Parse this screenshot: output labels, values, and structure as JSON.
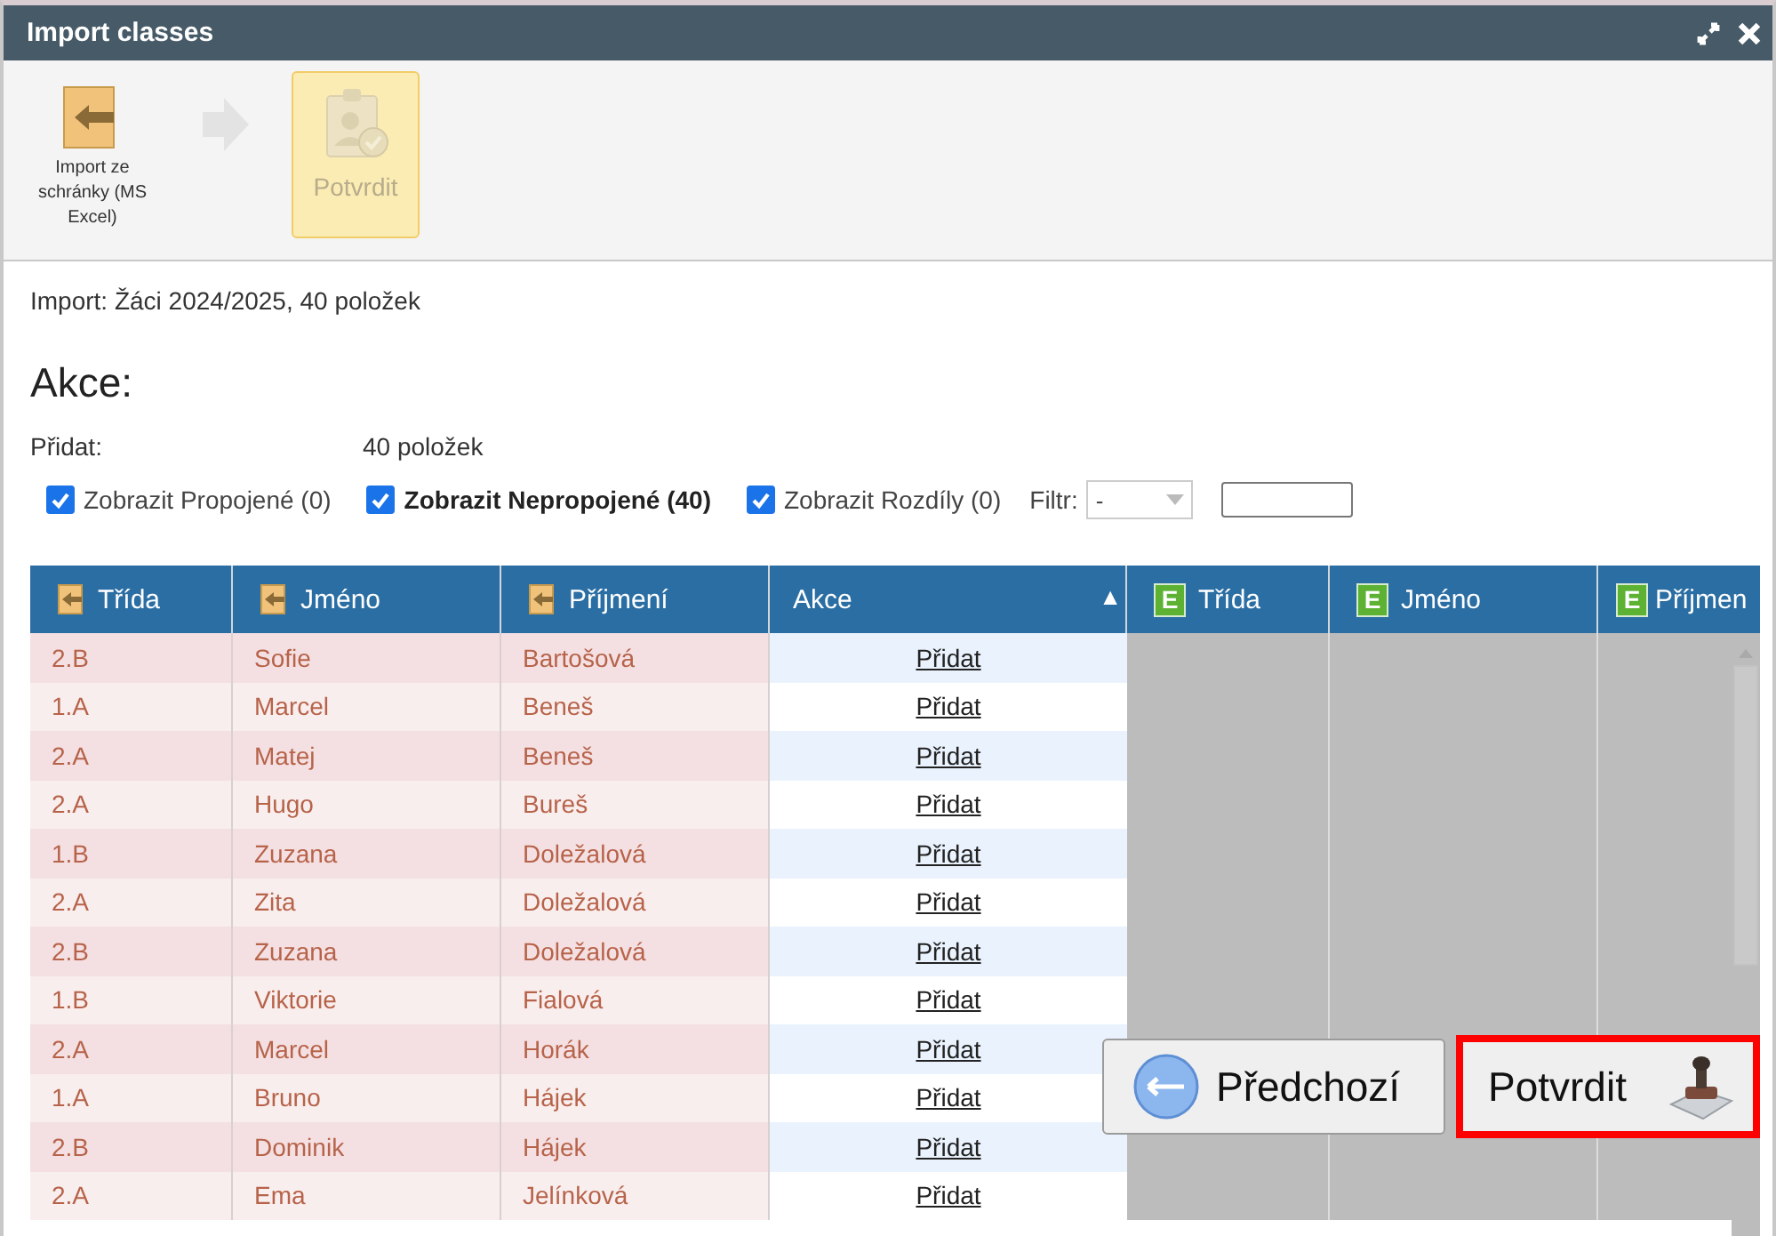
{
  "window": {
    "title": "Import classes"
  },
  "toolbar": [
    {
      "kind": "import",
      "label": "Import ze schránky (MS Excel)",
      "selected": false,
      "disabled": false
    },
    {
      "kind": "arrow"
    },
    {
      "kind": "confirm",
      "label": "Potvrdit",
      "selected": true,
      "disabled": true
    }
  ],
  "summary": "Import: Žáci 2024/2025, 40 položek",
  "section_title": "Akce:",
  "stats": [
    {
      "label": "Přidat:",
      "value": "40 položek"
    }
  ],
  "filters": [
    {
      "label": "Zobrazit Propojené (0)",
      "checked": true,
      "bold": false
    },
    {
      "label": "Zobrazit Nepropojené (40)",
      "checked": true,
      "bold": true
    },
    {
      "label": "Zobrazit Rozdíly (0)",
      "checked": true,
      "bold": false
    }
  ],
  "filter_select": {
    "label": "Filtr:",
    "value": "-"
  },
  "table": {
    "columns": [
      {
        "label": "Třída",
        "kind": "import"
      },
      {
        "label": "Jméno",
        "kind": "import"
      },
      {
        "label": "Příjmení",
        "kind": "import"
      },
      {
        "label": "Akce",
        "kind": "action",
        "sort": "▲"
      },
      {
        "label": "Třída",
        "kind": "existing",
        "badge": "E"
      },
      {
        "label": "Jméno",
        "kind": "existing",
        "badge": "E"
      },
      {
        "label": "Příjmen",
        "kind": "existing",
        "badge": "E"
      }
    ],
    "rows": [
      [
        "2.B",
        "Sofie",
        "Bartošová",
        "Přidat"
      ],
      [
        "1.A",
        "Marcel",
        "Beneš",
        "Přidat"
      ],
      [
        "2.A",
        "Matej",
        "Beneš",
        "Přidat"
      ],
      [
        "2.A",
        "Hugo",
        "Bureš",
        "Přidat"
      ],
      [
        "1.B",
        "Zuzana",
        "Doležalová",
        "Přidat"
      ],
      [
        "2.A",
        "Zita",
        "Doležalová",
        "Přidat"
      ],
      [
        "2.B",
        "Zuzana",
        "Doležalová",
        "Přidat"
      ],
      [
        "1.B",
        "Viktorie",
        "Fialová",
        "Přidat"
      ],
      [
        "2.A",
        "Marcel",
        "Horák",
        "Přidat"
      ],
      [
        "1.A",
        "Bruno",
        "Hájek",
        "Přidat"
      ],
      [
        "2.B",
        "Dominik",
        "Hájek",
        "Přidat"
      ],
      [
        "2.A",
        "Ema",
        "Jelínková",
        "Přidat"
      ]
    ]
  },
  "footer_buttons": [
    {
      "kind": "back",
      "label": "Předchozí",
      "highlighted": false
    },
    {
      "kind": "confirm",
      "label": "Potvrdit",
      "highlighted": true
    }
  ]
}
